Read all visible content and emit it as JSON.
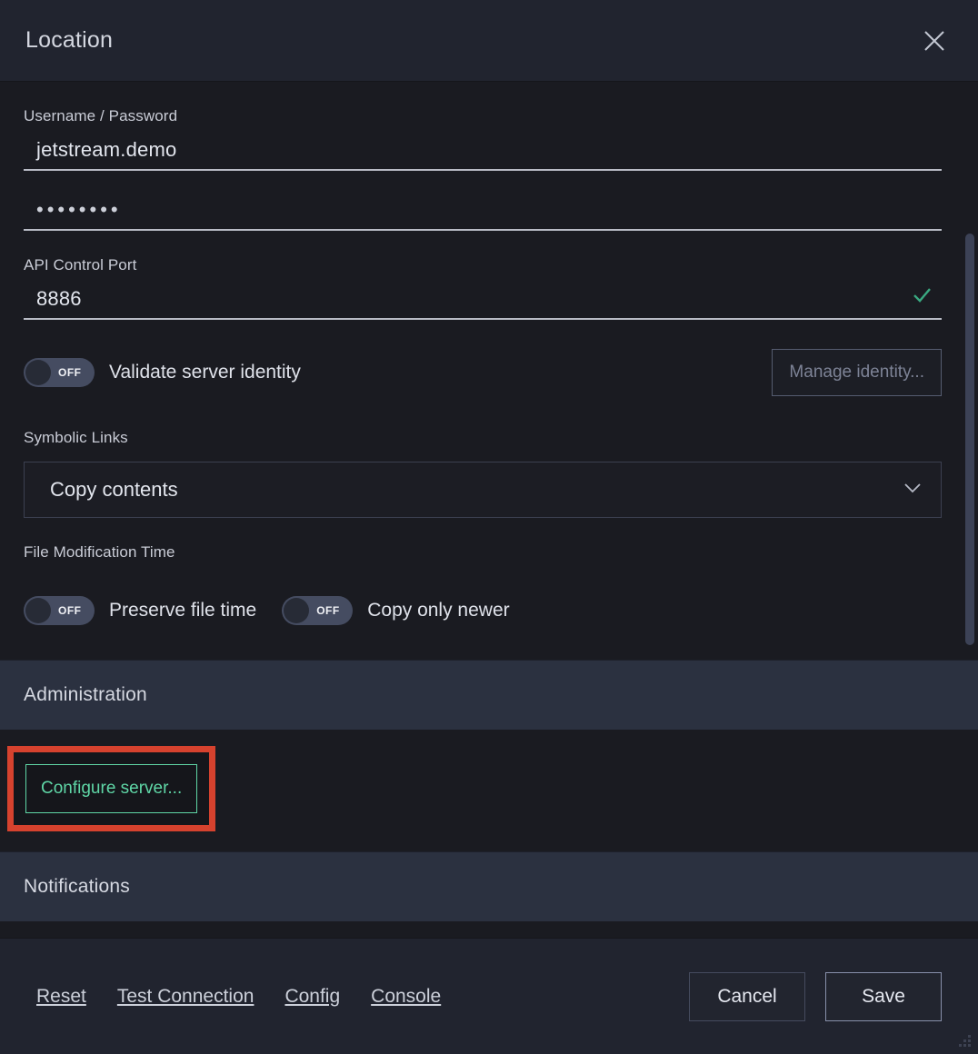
{
  "window": {
    "title": "Location",
    "close_icon": "close-icon",
    "resize_grip": "resize-grip"
  },
  "form": {
    "credentials_label": "Username / Password",
    "username_value": "jetstream.demo",
    "password_masked": "••••••••",
    "port_label": "API Control Port",
    "port_value": "8886",
    "port_valid_icon": "check-icon",
    "validate_identity": {
      "toggle_state": "OFF",
      "label": "Validate server identity"
    },
    "manage_identity_label": "Manage identity...",
    "symbolic_links_label": "Symbolic Links",
    "symbolic_links_value": "Copy contents",
    "symbolic_links_chevron": "chevron-down-icon",
    "file_mod_time_label": "File Modification Time",
    "preserve_file_time": {
      "toggle_state": "OFF",
      "label": "Preserve file time"
    },
    "copy_only_newer": {
      "toggle_state": "OFF",
      "label": "Copy only newer"
    }
  },
  "sections": {
    "administration_title": "Administration",
    "configure_server_label": "Configure server...",
    "notifications_title": "Notifications"
  },
  "footer": {
    "links": [
      {
        "label": "Reset"
      },
      {
        "label": "Test Connection"
      },
      {
        "label": "Config"
      },
      {
        "label": "Console"
      }
    ],
    "cancel_label": "Cancel",
    "save_label": "Save"
  },
  "colors": {
    "accent_green": "#5fd6a6",
    "annotation_red": "#d6422e",
    "body_bg": "#1a1b21",
    "chrome_bg": "#21242f",
    "section_band": "#2b3140",
    "text_primary": "#e3e6ee"
  }
}
